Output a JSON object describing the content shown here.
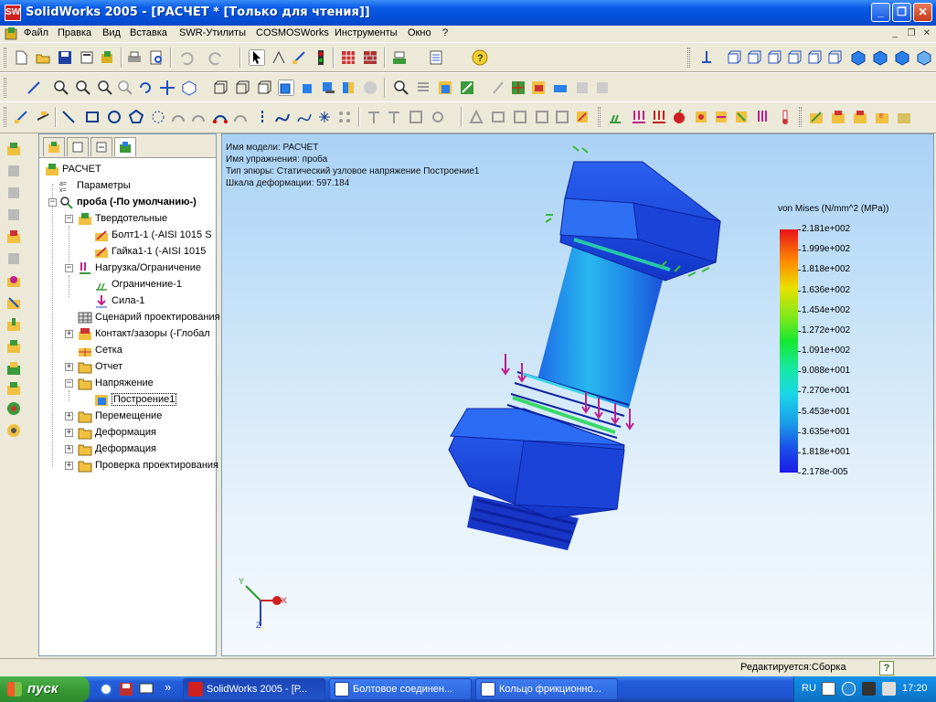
{
  "window": {
    "title": "SolidWorks 2005 - [РАСЧЕТ * [Только для чтения]]",
    "app_icon_text": "SW",
    "min_glyph": "_",
    "restore_glyph": "❐",
    "close_glyph": "✕"
  },
  "menu": {
    "items": [
      "Файл",
      "Правка",
      "Вид",
      "Вставка",
      "SWR-Утилиты",
      "COSMOSWorks",
      "Инструменты",
      "Окно",
      "?"
    ]
  },
  "feature_tree": {
    "root": "РАСЧЕТ",
    "params": "Параметры",
    "study": "проба (-По умолчанию-)",
    "solids": "Твердотельные",
    "bolt": "Болт1-1 (-AISI 1015 S",
    "nut": "Гайка1-1 (-AISI 1015",
    "loads": "Нагрузка/Ограничение",
    "restraint": "Ограничение-1",
    "force": "Сила-1",
    "scenario": "Сценарий проектирования",
    "contact": "Контакт/зазоры (-Глобал",
    "mesh": "Сетка",
    "report": "Отчет",
    "stress": "Напряжение",
    "plot1": "Построение1",
    "displacement": "Перемещение",
    "deformation1": "Деформация",
    "deformation2": "Деформация",
    "design_check": "Проверка проектирования"
  },
  "viewport": {
    "model_name": "Имя модели: РАСЧЕТ",
    "study_name": "Имя упражнения: проба",
    "plot_type": "Тип эпюры: Статический узловое напряжение Построение1",
    "deform_scale": "Шкала деформации: 597.184",
    "triad": {
      "x": "X",
      "y": "Y",
      "z": "Z"
    }
  },
  "legend": {
    "title": "von Mises (N/mm^2 (MPa))",
    "values": [
      "2.181e+002",
      "1.999e+002",
      "1.818e+002",
      "1.636e+002",
      "1.454e+002",
      "1.272e+002",
      "1.091e+002",
      "9.088e+001",
      "7.270e+001",
      "5.453e+001",
      "3.635e+001",
      "1.818e+001",
      "2.178e-005"
    ],
    "colors": [
      "#e8121a",
      "#1a1ae8"
    ]
  },
  "status": {
    "text": "Редактируется:Сборка",
    "help_glyph": "?"
  },
  "taskbar": {
    "start": "пуск",
    "more_glyph": "»",
    "tasks": [
      {
        "label": "SolidWorks 2005 - [Р..."
      },
      {
        "label": "Болтовое соединен..."
      },
      {
        "label": "Кольцо фрикционно..."
      }
    ],
    "lang": "RU",
    "clock": "17:20"
  }
}
